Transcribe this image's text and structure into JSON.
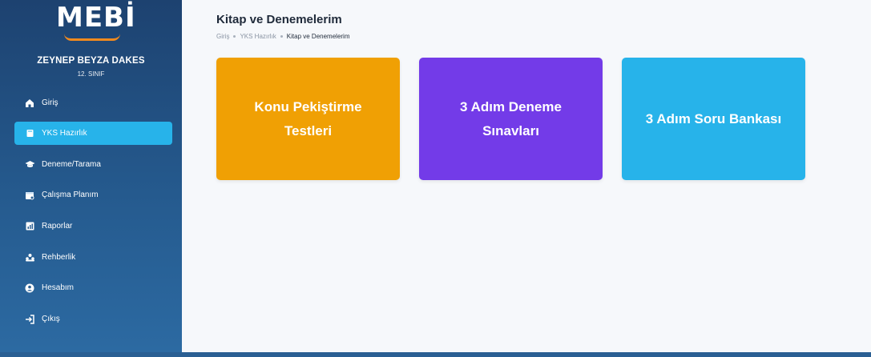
{
  "logo": {
    "text": "MEBİ"
  },
  "user": {
    "name": "ZEYNEP BEYZA DAKES",
    "class": "12. SINIF"
  },
  "sidebar": {
    "items": [
      {
        "label": "Giriş",
        "icon": "home-icon",
        "active": false
      },
      {
        "label": "YKS Hazırlık",
        "icon": "book-icon",
        "active": true
      },
      {
        "label": "Deneme/Tarama",
        "icon": "graduation-cap-icon",
        "active": false
      },
      {
        "label": "Çalışma Planım",
        "icon": "calendar-icon",
        "active": false
      },
      {
        "label": "Raporlar",
        "icon": "chart-icon",
        "active": false
      },
      {
        "label": "Rehberlik",
        "icon": "people-icon",
        "active": false
      },
      {
        "label": "Hesabım",
        "icon": "user-icon",
        "active": false
      },
      {
        "label": "Çıkış",
        "icon": "logout-icon",
        "active": false
      }
    ]
  },
  "header": {
    "title": "Kitap ve Denemelerim",
    "breadcrumb": [
      "Giriş",
      "YKS Hazırlık",
      "Kitap ve Denemelerim"
    ]
  },
  "cards": [
    {
      "label": "Konu Pekiştirme Testleri",
      "color": "#f0a004"
    },
    {
      "label": "3 Adım Deneme Sınavları",
      "color": "#733be8"
    },
    {
      "label": "3 Adım Soru Bankası",
      "color": "#27b3ea"
    }
  ],
  "colors": {
    "sidebar_top": "#1d4270",
    "sidebar_bottom": "#2c6aa2",
    "active_item": "#27b3ea",
    "logo_accent": "#f28a1e",
    "main_bg": "#f6f8fb"
  }
}
